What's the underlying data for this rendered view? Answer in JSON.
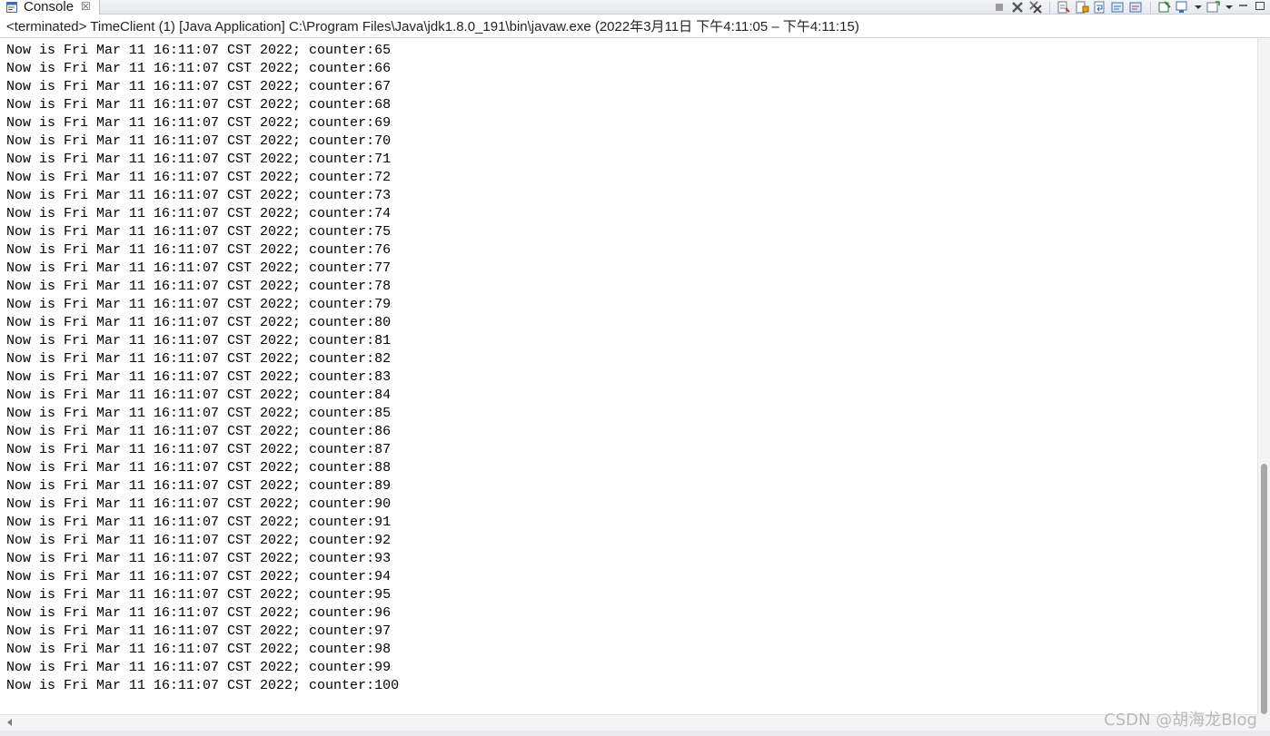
{
  "tab": {
    "label": "Console",
    "close_glyph": "☒",
    "icon": "console-icon"
  },
  "toolbar": {
    "buttons": [
      {
        "name": "terminate-button",
        "icon": "stop-icon"
      },
      {
        "name": "remove-launch-button",
        "icon": "remove-x-icon"
      },
      {
        "name": "remove-all-terminated-button",
        "icon": "remove-all-x-icon"
      },
      {
        "name": "clear-console-button",
        "icon": "clear-console-icon"
      },
      {
        "name": "scroll-lock-button",
        "icon": "scroll-lock-icon"
      },
      {
        "name": "word-wrap-button",
        "icon": "word-wrap-icon"
      },
      {
        "name": "show-on-stdout-button",
        "icon": "show-stdout-icon"
      },
      {
        "name": "show-on-stderr-button",
        "icon": "show-stderr-icon"
      },
      {
        "name": "pin-console-button",
        "icon": "pin-icon"
      },
      {
        "name": "display-console-button",
        "icon": "display-console-icon"
      },
      {
        "name": "open-console-button",
        "icon": "open-console-icon"
      },
      {
        "name": "minimize-button",
        "icon": "minimize-icon"
      },
      {
        "name": "maximize-button",
        "icon": "maximize-icon"
      }
    ]
  },
  "title_line": "<terminated> TimeClient (1) [Java Application] C:\\Program Files\\Java\\jdk1.8.0_191\\bin\\javaw.exe  (2022年3月11日 下午4:11:05 – 下午4:11:15)",
  "output_lines": [
    "Now is Fri Mar 11 16:11:07 CST 2022; counter:65",
    "Now is Fri Mar 11 16:11:07 CST 2022; counter:66",
    "Now is Fri Mar 11 16:11:07 CST 2022; counter:67",
    "Now is Fri Mar 11 16:11:07 CST 2022; counter:68",
    "Now is Fri Mar 11 16:11:07 CST 2022; counter:69",
    "Now is Fri Mar 11 16:11:07 CST 2022; counter:70",
    "Now is Fri Mar 11 16:11:07 CST 2022; counter:71",
    "Now is Fri Mar 11 16:11:07 CST 2022; counter:72",
    "Now is Fri Mar 11 16:11:07 CST 2022; counter:73",
    "Now is Fri Mar 11 16:11:07 CST 2022; counter:74",
    "Now is Fri Mar 11 16:11:07 CST 2022; counter:75",
    "Now is Fri Mar 11 16:11:07 CST 2022; counter:76",
    "Now is Fri Mar 11 16:11:07 CST 2022; counter:77",
    "Now is Fri Mar 11 16:11:07 CST 2022; counter:78",
    "Now is Fri Mar 11 16:11:07 CST 2022; counter:79",
    "Now is Fri Mar 11 16:11:07 CST 2022; counter:80",
    "Now is Fri Mar 11 16:11:07 CST 2022; counter:81",
    "Now is Fri Mar 11 16:11:07 CST 2022; counter:82",
    "Now is Fri Mar 11 16:11:07 CST 2022; counter:83",
    "Now is Fri Mar 11 16:11:07 CST 2022; counter:84",
    "Now is Fri Mar 11 16:11:07 CST 2022; counter:85",
    "Now is Fri Mar 11 16:11:07 CST 2022; counter:86",
    "Now is Fri Mar 11 16:11:07 CST 2022; counter:87",
    "Now is Fri Mar 11 16:11:07 CST 2022; counter:88",
    "Now is Fri Mar 11 16:11:07 CST 2022; counter:89",
    "Now is Fri Mar 11 16:11:07 CST 2022; counter:90",
    "Now is Fri Mar 11 16:11:07 CST 2022; counter:91",
    "Now is Fri Mar 11 16:11:07 CST 2022; counter:92",
    "Now is Fri Mar 11 16:11:07 CST 2022; counter:93",
    "Now is Fri Mar 11 16:11:07 CST 2022; counter:94",
    "Now is Fri Mar 11 16:11:07 CST 2022; counter:95",
    "Now is Fri Mar 11 16:11:07 CST 2022; counter:96",
    "Now is Fri Mar 11 16:11:07 CST 2022; counter:97",
    "Now is Fri Mar 11 16:11:07 CST 2022; counter:98",
    "Now is Fri Mar 11 16:11:07 CST 2022; counter:99",
    "Now is Fri Mar 11 16:11:07 CST 2022; counter:100"
  ],
  "scroll": {
    "vertical_position_fraction": 0.63,
    "vertical_visible_fraction": 0.37
  },
  "watermark": "CSDN @胡海龙Blog",
  "colors": {
    "text": "#000000",
    "tab_bg": "#ffffff",
    "toolbar_bg": "#e6e9ef",
    "accent": "#3b6fb6"
  }
}
